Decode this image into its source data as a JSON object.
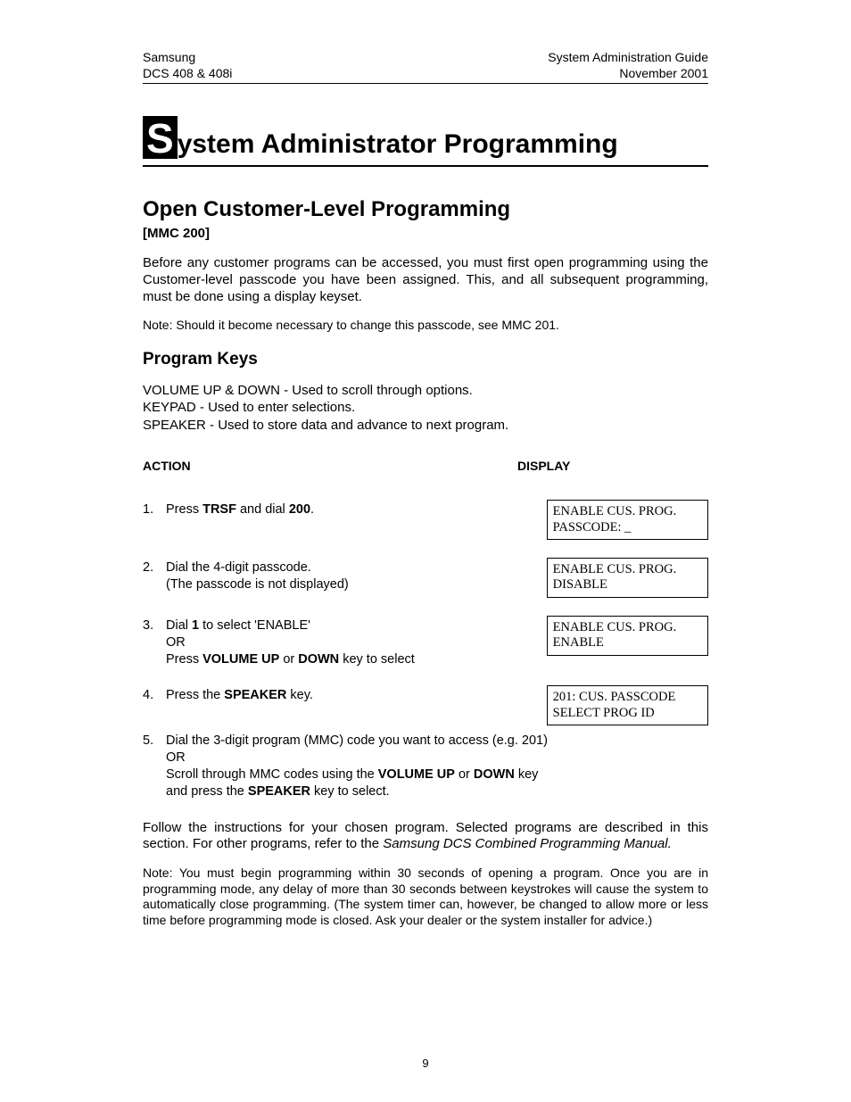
{
  "header": {
    "left1": "Samsung",
    "left2": "DCS 408 & 408i",
    "right1": "System Administration Guide",
    "right2": "November 2001"
  },
  "title": {
    "dropcap": "S",
    "rest": "ystem Administrator Programming"
  },
  "section_title": "Open Customer-Level Programming",
  "mmc": "[MMC 200]",
  "intro": "Before any customer programs can be accessed, you must first open programming using the Customer-level passcode you have been assigned. This, and all subsequent programming, must be done using a display keyset.",
  "note1": "Note: Should it become necessary to change this passcode, see MMC 201.",
  "sub_title": "Program Keys",
  "keys": {
    "l1": "VOLUME UP & DOWN - Used to scroll through options.",
    "l2": "KEYPAD - Used to enter selections.",
    "l3": "SPEAKER - Used to store data and advance to next program."
  },
  "col_action": "ACTION",
  "col_display": "DISPLAY",
  "steps": [
    {
      "num": "1.",
      "action_html": "Press <b>TRSF</b> and dial <b>200</b>.",
      "display": "ENABLE CUS. PROG.\nPASSCODE: _"
    },
    {
      "num": "2.",
      "action_html": "Dial the 4-digit passcode.<br>(The passcode is not displayed)",
      "display": "ENABLE CUS. PROG.\nDISABLE"
    },
    {
      "num": "3.",
      "action_html": "Dial <b>1</b> to select 'ENABLE'<br>OR<br>Press <b>VOLUME UP</b> or <b>DOWN</b> key to select",
      "display": "ENABLE CUS. PROG.\nENABLE"
    },
    {
      "num": "4.",
      "action_html": "Press the <b>SPEAKER</b> key.",
      "display": "201: CUS. PASSCODE\nSELECT PROG ID"
    },
    {
      "num": "5.",
      "action_html": "Dial the 3-digit program (MMC) code you want to access (e.g. 201)<br>OR<br>Scroll through MMC codes using the <b>VOLUME UP</b> or <b>DOWN</b> key and press the <b>SPEAKER</b> key to select.",
      "display": ""
    }
  ],
  "follow_pre": "Follow the instructions for your chosen program. Selected programs are described in this section. For other programs, refer to the ",
  "follow_italic": "Samsung DCS Combined Programming Manual.",
  "note2": "Note: You must begin programming within 30 seconds of opening a program. Once you are in programming mode, any delay of more than 30 seconds between keystrokes will cause the system to automatically close programming. (The system timer can, however, be changed to allow more or less time before programming mode is closed. Ask your dealer or the system installer for advice.)",
  "page_number": "9"
}
